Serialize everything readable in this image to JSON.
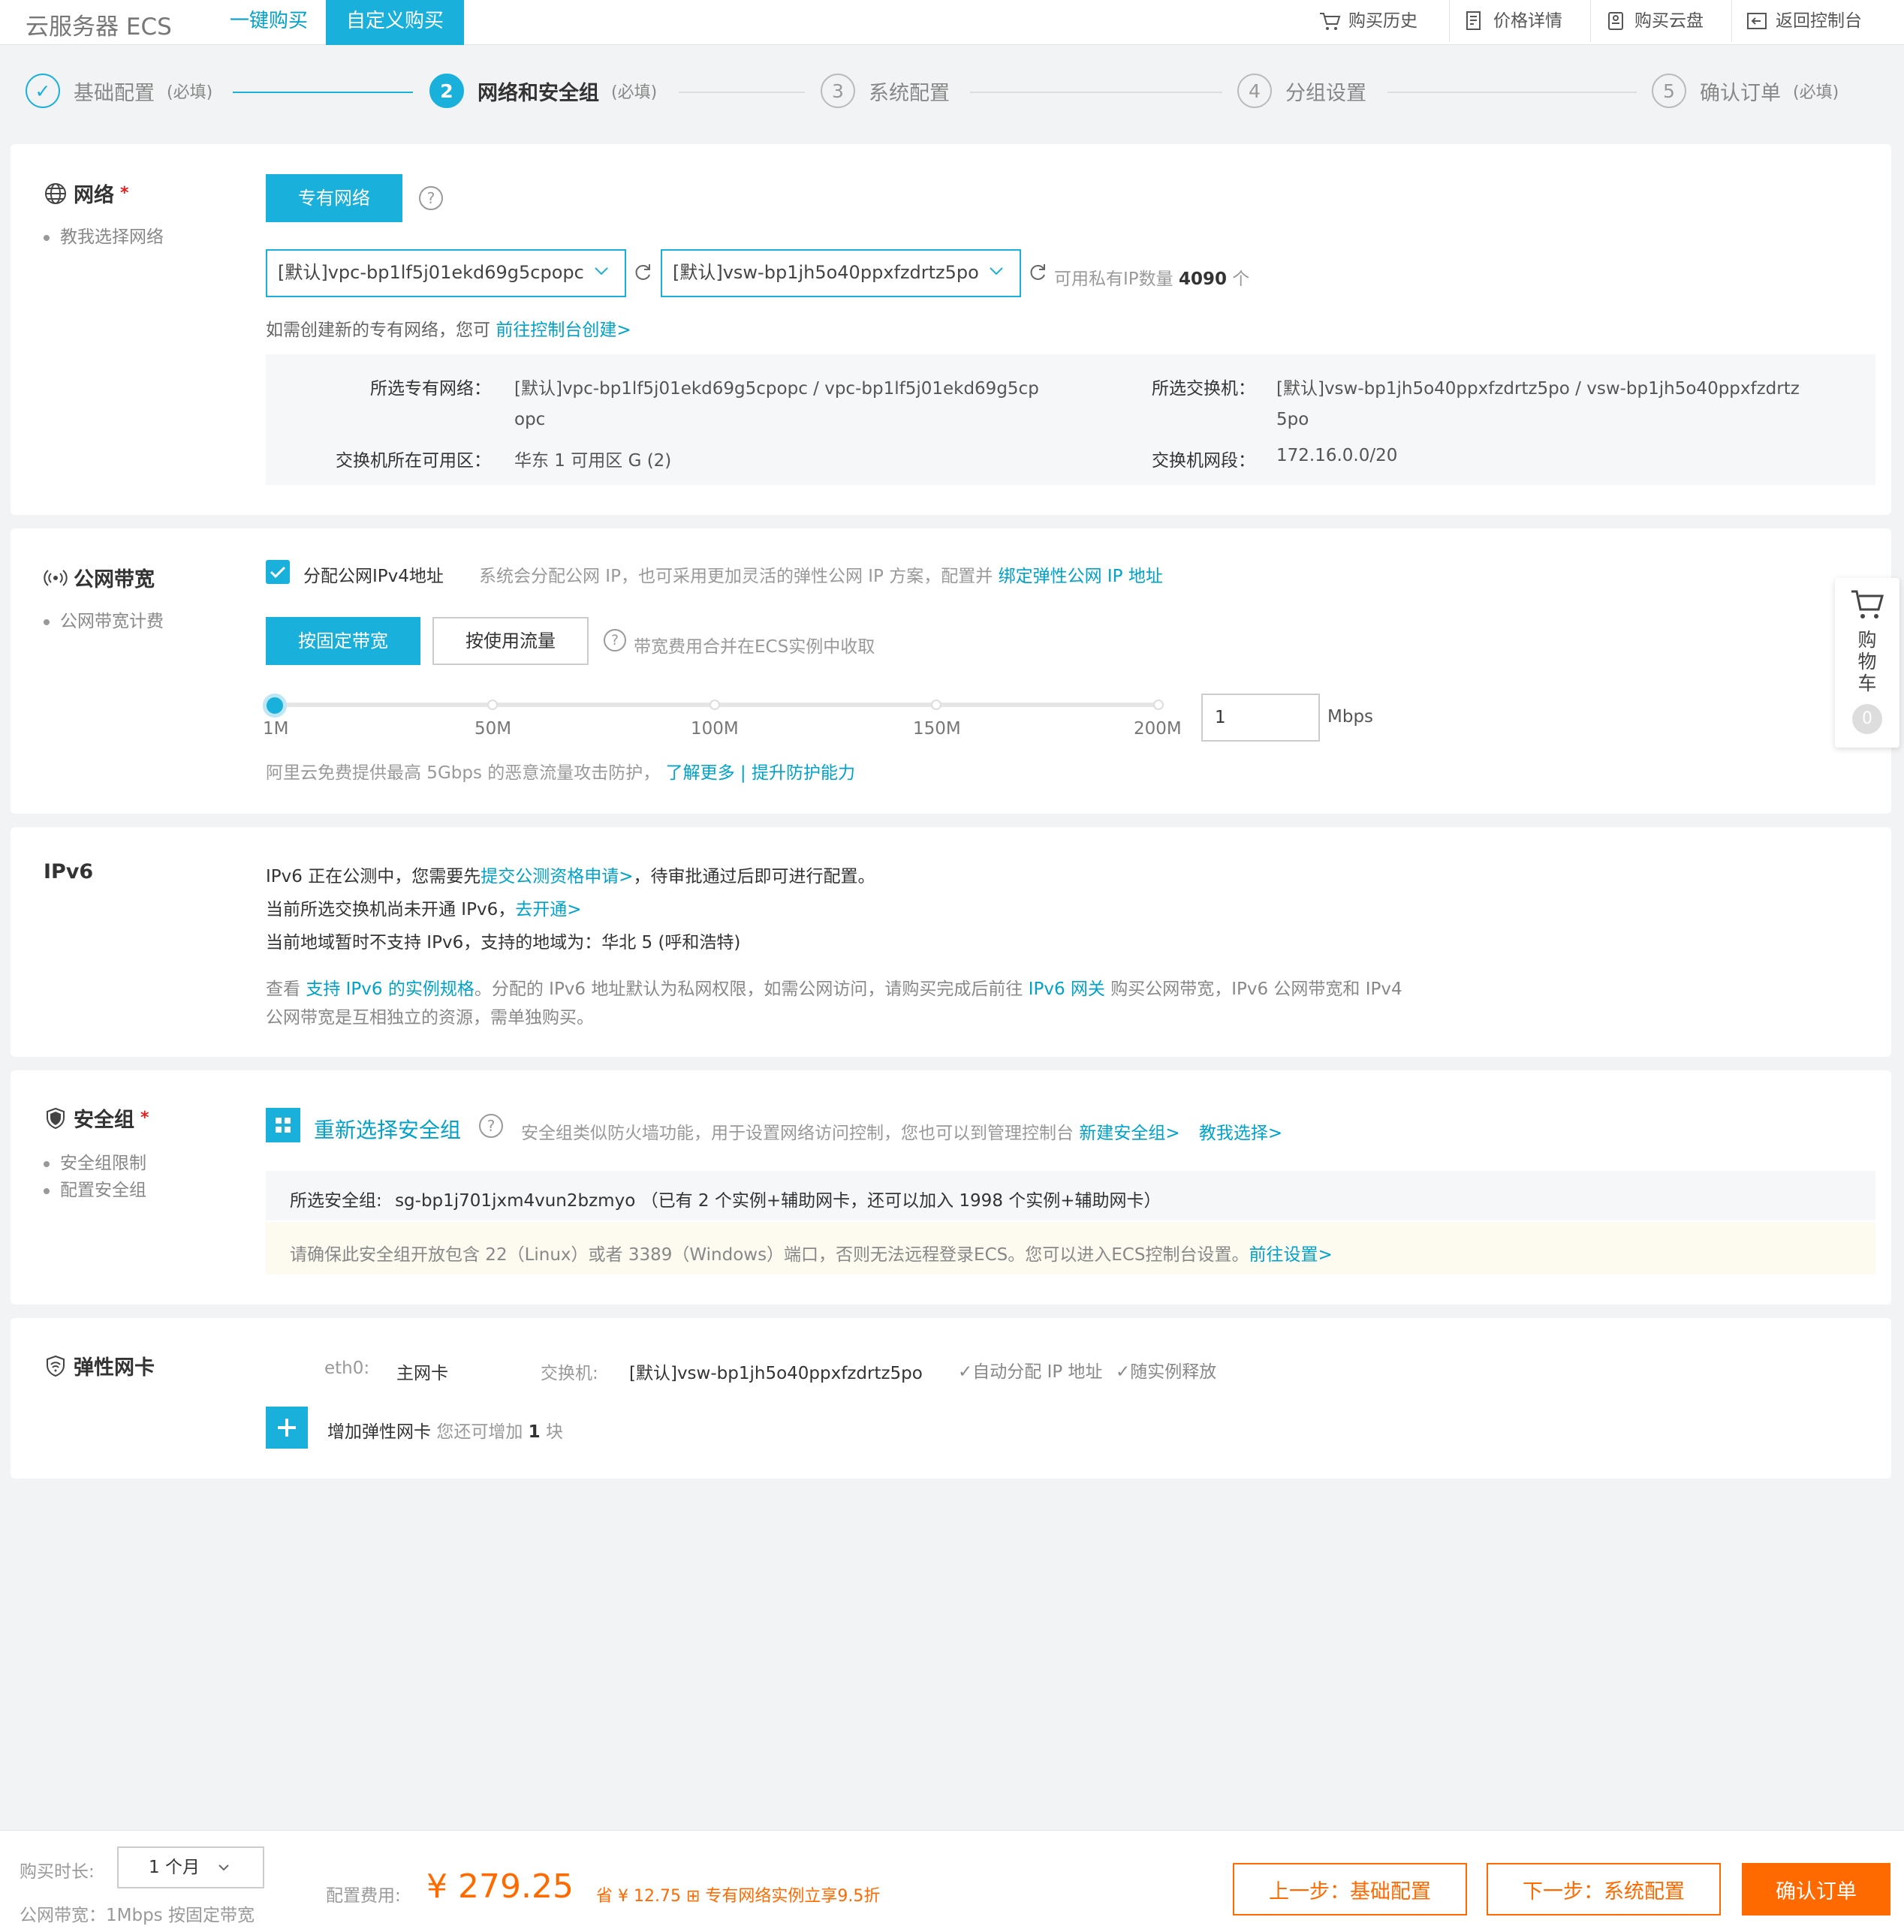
{
  "topbar": {
    "brand": "云服务器 ECS",
    "tab_quick": "一键购买",
    "tab_custom": "自定义购买",
    "links": {
      "history": "购买历史",
      "price": "价格详情",
      "disk": "购买云盘",
      "console": "返回控制台"
    }
  },
  "steps": [
    {
      "num": "✓",
      "label": "基础配置",
      "note": "(必填)"
    },
    {
      "num": "2",
      "label": "网络和安全组",
      "note": "(必填)"
    },
    {
      "num": "3",
      "label": "系统配置",
      "note": ""
    },
    {
      "num": "4",
      "label": "分组设置",
      "note": ""
    },
    {
      "num": "5",
      "label": "确认订单",
      "note": "(必填)"
    }
  ],
  "network": {
    "title": "网络",
    "star": "*",
    "help": "教我选择网络",
    "vpc_button": "专有网络",
    "vpc_select": "[默认]vpc-bp1lf5j01ekd69g5cpopc",
    "vsw_select": "[默认]vsw-bp1jh5o40ppxfzdrtz5po",
    "ip_count_label": "可用私有IP数量",
    "ip_count": "4090",
    "ip_unit": "个",
    "create_hint": "如需创建新的专有网络，您可",
    "create_link": "前往控制台创建>",
    "info": {
      "vpc_label": "所选专有网络：",
      "vpc_value_1": "[默认]vpc-bp1lf5j01ekd69g5cpopc / vpc-bp1lf5j01ekd69g5cp",
      "vpc_value_2": "opc",
      "zone_label": "交换机所在可用区：",
      "zone_value": "华东 1 可用区 G (2)",
      "vsw_label": "所选交换机：",
      "vsw_value_1": "[默认]vsw-bp1jh5o40ppxfzdrtz5po / vsw-bp1jh5o40ppxfzdrtz",
      "vsw_value_2": "5po",
      "cidr_label": "交换机网段：",
      "cidr_value": "172.16.0.0/20"
    }
  },
  "bandwidth": {
    "title": "公网带宽",
    "help": "公网带宽计费",
    "assign_label": "分配公网IPv4地址",
    "assign_desc": "系统会分配公网 IP，也可采用更加灵活的弹性公网 IP 方案，配置并",
    "assign_link": "绑定弹性公网 IP 地址",
    "fixed_btn": "按固定带宽",
    "traffic_btn": "按使用流量",
    "fee_hint": "带宽费用合并在ECS实例中收取",
    "ticks": [
      "1M",
      "50M",
      "100M",
      "150M",
      "200M"
    ],
    "value": "1",
    "unit": "Mbps",
    "ddos_text": "阿里云免费提供最高 5Gbps 的恶意流量攻击防护，",
    "ddos_link1": "了解更多",
    "ddos_sep": "|",
    "ddos_link2": "提升防护能力"
  },
  "ipv6": {
    "title": "IPv6",
    "line1_a": "IPv6 正在公测中，您需要先",
    "line1_link": "提交公测资格申请>",
    "line1_b": "，待审批通过后即可进行配置。",
    "line2_a": "当前所选交换机尚未开通 IPv6，",
    "line2_link": "去开通>",
    "line3": "当前地域暂时不支持 IPv6，支持的地域为：华北 5 (呼和浩特)",
    "note_a": "查看",
    "note_link1": "支持 IPv6 的实例规格",
    "note_b": "。分配的 IPv6 地址默认为私网权限，如需公网访问，请购买完成后前往",
    "note_link2": "IPv6 网关",
    "note_c": "购买公网带宽，IPv6 公网带宽和 IPv4",
    "note_d": "公网带宽是互相独立的资源，需单独购买。"
  },
  "security": {
    "title": "安全组",
    "star": "*",
    "help1": "安全组限制",
    "help2": "配置安全组",
    "reselect": "重新选择安全组",
    "desc": "安全组类似防火墙功能，用于设置网络访问控制，您也可以到管理控制台",
    "link_new": "新建安全组>",
    "link_teach": "教我选择>",
    "selected_label": "所选安全组:",
    "selected_value": "sg-bp1j701jxm4vun2bzmyo （已有 2 个实例+辅助网卡，还可以加入 1998 个实例+辅助网卡）",
    "warn": "请确保此安全组开放包含 22（Linux）或者 3389（Windows）端口，否则无法远程登录ECS。您可以进入ECS控制台设置。",
    "warn_link": "前往设置>"
  },
  "eni": {
    "title": "弹性网卡",
    "eth": "eth0:",
    "primary": "主网卡",
    "vsw_label": "交换机:",
    "vsw_value": "[默认]vsw-bp1jh5o40ppxfzdrtz5po",
    "auto_ip": "✓自动分配 IP 地址",
    "release": "✓随实例释放",
    "add_label": "增加弹性网卡",
    "add_hint_a": "您还可增加",
    "add_count": "1",
    "add_hint_b": "块"
  },
  "cart": {
    "label": "购物车",
    "count": "0"
  },
  "bottom": {
    "duration_label": "购买时长:",
    "duration_value": "1 个月",
    "bandwidth_summary": "公网带宽：1Mbps 按固定带宽",
    "fee_label": "配置费用:",
    "currency": "¥",
    "price": "279.25",
    "save_label": "省 ¥",
    "save_value": "12.75",
    "promo": "专有网络实例立享9.5折",
    "prev_btn": "上一步：基础配置",
    "next_btn": "下一步：系统配置",
    "confirm_btn": "确认订单"
  },
  "colors": {
    "accent": "#1ab0dc",
    "link": "#00a2ca",
    "orange": "#ff6a00",
    "required": "#e02020"
  }
}
